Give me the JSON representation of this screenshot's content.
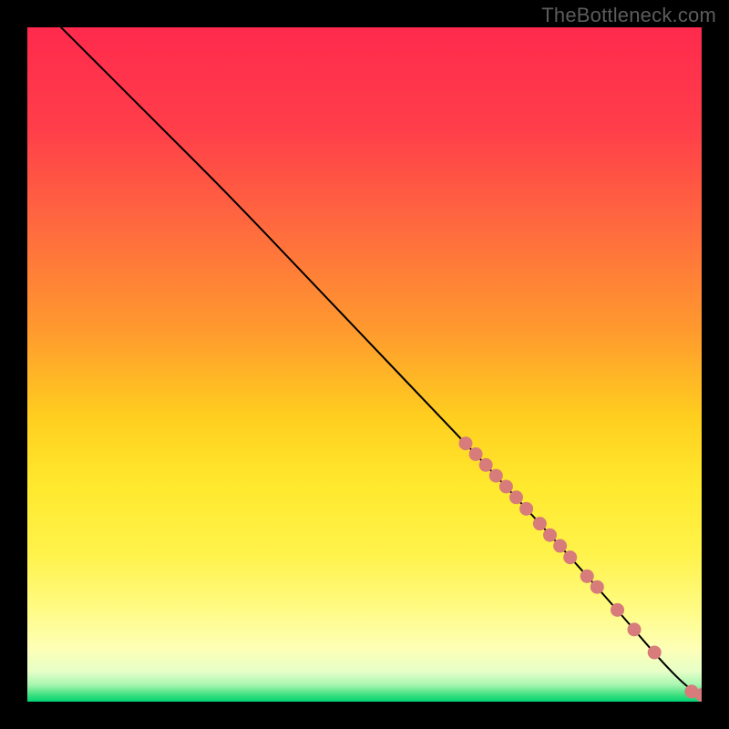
{
  "watermark": "TheBottleneck.com",
  "chart_data": {
    "type": "line",
    "title": "",
    "xlabel": "",
    "ylabel": "",
    "xlim": [
      0,
      100
    ],
    "ylim": [
      0,
      100
    ],
    "gradient_stops": [
      {
        "offset": 0.0,
        "color": "#ff2a4d"
      },
      {
        "offset": 0.15,
        "color": "#ff3e4a"
      },
      {
        "offset": 0.3,
        "color": "#ff6b3e"
      },
      {
        "offset": 0.45,
        "color": "#ff9a2e"
      },
      {
        "offset": 0.58,
        "color": "#ffcf1f"
      },
      {
        "offset": 0.68,
        "color": "#ffe92e"
      },
      {
        "offset": 0.78,
        "color": "#fff24a"
      },
      {
        "offset": 0.86,
        "color": "#fffb82"
      },
      {
        "offset": 0.92,
        "color": "#feffb5"
      },
      {
        "offset": 0.955,
        "color": "#e7ffc8"
      },
      {
        "offset": 0.975,
        "color": "#a8f5b0"
      },
      {
        "offset": 0.99,
        "color": "#3fe07f"
      },
      {
        "offset": 1.0,
        "color": "#00d373"
      }
    ],
    "curve": [
      {
        "x": 5,
        "y": 100
      },
      {
        "x": 8,
        "y": 97
      },
      {
        "x": 12,
        "y": 93
      },
      {
        "x": 20,
        "y": 85
      },
      {
        "x": 30,
        "y": 75
      },
      {
        "x": 40,
        "y": 64.5
      },
      {
        "x": 50,
        "y": 54
      },
      {
        "x": 60,
        "y": 43.5
      },
      {
        "x": 70,
        "y": 33
      },
      {
        "x": 80,
        "y": 22
      },
      {
        "x": 88,
        "y": 13
      },
      {
        "x": 94,
        "y": 6
      },
      {
        "x": 98,
        "y": 2
      },
      {
        "x": 100,
        "y": 1
      }
    ],
    "markers": [
      {
        "x": 65,
        "y": 38.3
      },
      {
        "x": 66.5,
        "y": 36.7
      },
      {
        "x": 68,
        "y": 35.1
      },
      {
        "x": 69.5,
        "y": 33.5
      },
      {
        "x": 71,
        "y": 31.9
      },
      {
        "x": 72.5,
        "y": 30.3
      },
      {
        "x": 74,
        "y": 28.6
      },
      {
        "x": 76,
        "y": 26.4
      },
      {
        "x": 77.5,
        "y": 24.7
      },
      {
        "x": 79,
        "y": 23.1
      },
      {
        "x": 80.5,
        "y": 21.4
      },
      {
        "x": 83,
        "y": 18.6
      },
      {
        "x": 84.5,
        "y": 17.0
      },
      {
        "x": 87.5,
        "y": 13.6
      },
      {
        "x": 90,
        "y": 10.7
      },
      {
        "x": 93,
        "y": 7.3
      },
      {
        "x": 98.5,
        "y": 1.5
      },
      {
        "x": 100,
        "y": 1.0
      }
    ],
    "marker_color": "#d77b7b",
    "marker_radius": 7.5,
    "curve_color": "#000000",
    "curve_width": 2
  }
}
